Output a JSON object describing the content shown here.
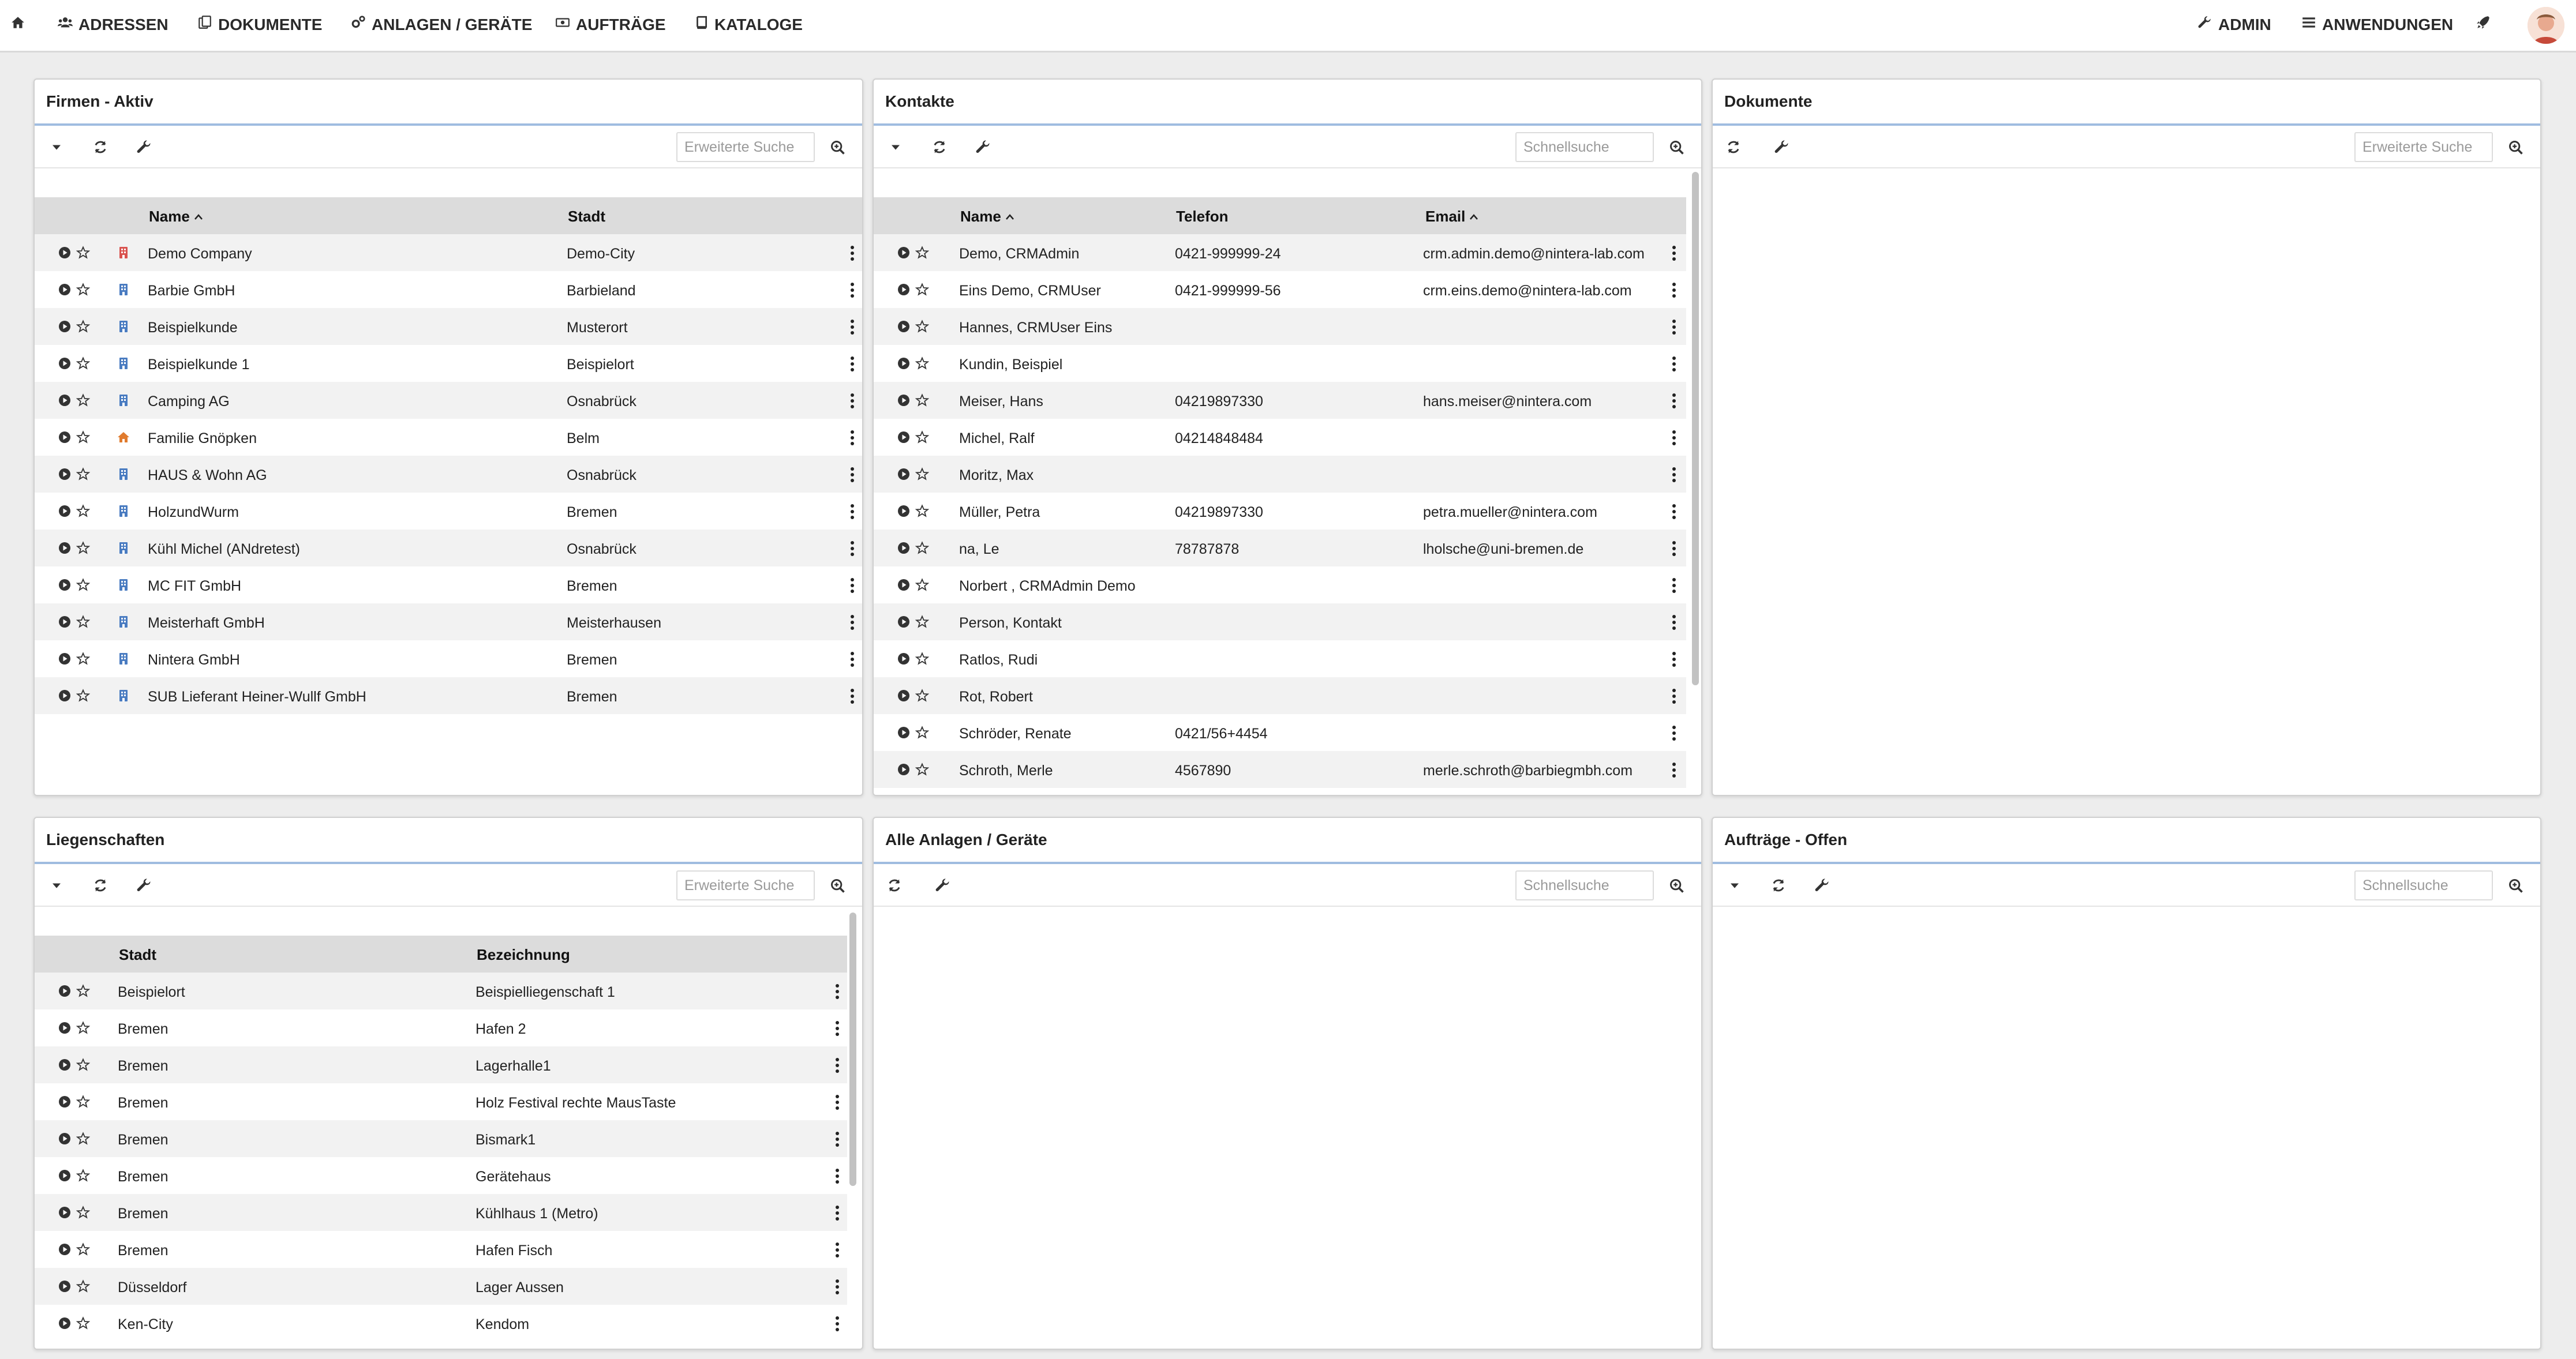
{
  "nav": {
    "items": [
      {
        "label": "",
        "icon": "home-icon"
      },
      {
        "label": "ADRESSEN",
        "icon": "users-icon"
      },
      {
        "label": "DOKUMENTE",
        "icon": "documents-icon"
      },
      {
        "label": "ANLAGEN / GERÄTE",
        "icon": "gears-icon"
      },
      {
        "label": "AUFTRÄGE",
        "icon": "money-icon"
      },
      {
        "label": "KATALOGE",
        "icon": "book-icon"
      }
    ],
    "right": [
      {
        "label": "ADMIN",
        "icon": "wrench-icon"
      },
      {
        "label": "ANWENDUNGEN",
        "icon": "list-icon"
      },
      {
        "label": "",
        "icon": "rocket-icon"
      }
    ]
  },
  "colors": {
    "accent_line": "#9fbce0",
    "company_icon": "#4a7cc1",
    "company_icon_red": "#d9534f",
    "home_icon_orange": "#e07b2e"
  },
  "panels": {
    "firmen": {
      "title": "Firmen - Aktiv",
      "search_placeholder": "Erweiterte Suche",
      "columns": [
        "Name",
        "Stadt"
      ],
      "rows": [
        {
          "name": "Demo Company",
          "stadt": "Demo-City",
          "icon": "building-icon-red"
        },
        {
          "name": "Barbie GmbH",
          "stadt": "Barbieland",
          "icon": "building-icon"
        },
        {
          "name": "Beispielkunde",
          "stadt": "Musterort",
          "icon": "building-icon"
        },
        {
          "name": "Beispielkunde 1",
          "stadt": "Beispielort",
          "icon": "building-icon"
        },
        {
          "name": "Camping AG",
          "stadt": "Osnabrück",
          "icon": "building-icon"
        },
        {
          "name": "Familie Gnöpken",
          "stadt": "Belm",
          "icon": "house-icon"
        },
        {
          "name": "HAUS & Wohn AG",
          "stadt": "Osnabrück",
          "icon": "building-icon"
        },
        {
          "name": "HolzundWurm",
          "stadt": "Bremen",
          "icon": "building-icon"
        },
        {
          "name": "Kühl Michel (ANdretest)",
          "stadt": "Osnabrück",
          "icon": "building-icon"
        },
        {
          "name": "MC FIT GmbH",
          "stadt": "Bremen",
          "icon": "building-icon"
        },
        {
          "name": "Meisterhaft GmbH",
          "stadt": "Meisterhausen",
          "icon": "building-icon"
        },
        {
          "name": "Nintera GmbH",
          "stadt": "Bremen",
          "icon": "building-icon"
        },
        {
          "name": "SUB Lieferant Heiner-Wullf GmbH",
          "stadt": "Bremen",
          "icon": "building-icon"
        }
      ]
    },
    "kontakte": {
      "title": "Kontakte",
      "search_placeholder": "Schnellsuche",
      "columns": [
        "Name",
        "Telefon",
        "Email"
      ],
      "rows": [
        {
          "name": "Demo, CRMAdmin",
          "telefon": "0421-999999-24",
          "email": "crm.admin.demo@nintera-lab.com"
        },
        {
          "name": "Eins Demo, CRMUser",
          "telefon": "0421-999999-56",
          "email": "crm.eins.demo@nintera-lab.com"
        },
        {
          "name": "Hannes, CRMUser Eins",
          "telefon": "",
          "email": ""
        },
        {
          "name": "Kundin, Beispiel",
          "telefon": "",
          "email": ""
        },
        {
          "name": "Meiser, Hans",
          "telefon": "04219897330",
          "email": "hans.meiser@nintera.com"
        },
        {
          "name": "Michel, Ralf",
          "telefon": "04214848484",
          "email": ""
        },
        {
          "name": "Moritz, Max",
          "telefon": "",
          "email": ""
        },
        {
          "name": "Müller, Petra",
          "telefon": "04219897330",
          "email": "petra.mueller@nintera.com"
        },
        {
          "name": "na, Le",
          "telefon": "78787878",
          "email": "lholsche@uni-bremen.de"
        },
        {
          "name": "Norbert , CRMAdmin Demo",
          "telefon": "",
          "email": ""
        },
        {
          "name": "Person, Kontakt",
          "telefon": "",
          "email": ""
        },
        {
          "name": "Ratlos, Rudi",
          "telefon": "",
          "email": ""
        },
        {
          "name": "Rot, Robert",
          "telefon": "",
          "email": ""
        },
        {
          "name": "Schröder, Renate",
          "telefon": "0421/56+4454",
          "email": ""
        },
        {
          "name": "Schroth, Merle",
          "telefon": "4567890",
          "email": "merle.schroth@barbiegmbh.com"
        }
      ]
    },
    "dokumente": {
      "title": "Dokumente",
      "search_placeholder": "Erweiterte Suche"
    },
    "liegenschaften": {
      "title": "Liegenschaften",
      "search_placeholder": "Erweiterte Suche",
      "columns": [
        "Stadt",
        "Bezeichnung"
      ],
      "rows": [
        {
          "stadt": "Beispielort",
          "bezeichnung": "Beispielliegenschaft 1"
        },
        {
          "stadt": "Bremen",
          "bezeichnung": "Hafen 2"
        },
        {
          "stadt": "Bremen",
          "bezeichnung": "Lagerhalle1"
        },
        {
          "stadt": "Bremen",
          "bezeichnung": "Holz Festival rechte MausTaste"
        },
        {
          "stadt": "Bremen",
          "bezeichnung": "Bismark1"
        },
        {
          "stadt": "Bremen",
          "bezeichnung": "Gerätehaus"
        },
        {
          "stadt": "Bremen",
          "bezeichnung": "Kühlhaus 1 (Metro)"
        },
        {
          "stadt": "Bremen",
          "bezeichnung": "Hafen Fisch"
        },
        {
          "stadt": "Düsseldorf",
          "bezeichnung": "Lager Aussen"
        },
        {
          "stadt": "Ken-City",
          "bezeichnung": "Kendom"
        }
      ]
    },
    "anlagen": {
      "title": "Alle Anlagen / Geräte",
      "search_placeholder": "Schnellsuche"
    },
    "auftraege": {
      "title": "Aufträge - Offen",
      "search_placeholder": "Schnellsuche"
    }
  }
}
